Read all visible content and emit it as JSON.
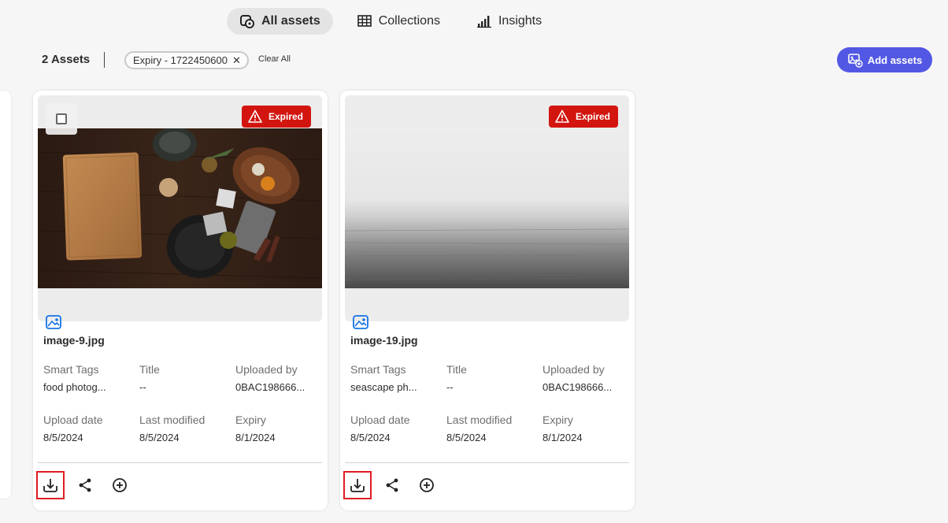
{
  "tabs": [
    {
      "label": "All assets",
      "icon": "assets-icon",
      "active": true
    },
    {
      "label": "Collections",
      "icon": "grid-icon",
      "active": false
    },
    {
      "label": "Insights",
      "icon": "insights-icon",
      "active": false
    }
  ],
  "toolbar": {
    "count_label": "2 Assets",
    "filter_chip": "Expiry - 1722450600",
    "clear_label": "Clear All",
    "add_label": "Add assets"
  },
  "colors": {
    "accent": "#5258e4",
    "expired": "#d31510",
    "highlight": "#e01b24"
  },
  "meta_labels": {
    "smart_tags": "Smart Tags",
    "title": "Title",
    "uploaded_by": "Uploaded by",
    "upload_date": "Upload date",
    "last_modified": "Last modified",
    "expiry": "Expiry"
  },
  "cards": [
    {
      "badge": "Expired",
      "filename": "image-9.jpg",
      "smart_tags": "food photog...",
      "title": "--",
      "uploaded_by": "0BAC198666...",
      "upload_date": "8/5/2024",
      "last_modified": "8/5/2024",
      "expiry": "8/1/2024"
    },
    {
      "badge": "Expired",
      "filename": "image-19.jpg",
      "smart_tags": "seascape ph...",
      "title": "--",
      "uploaded_by": "0BAC198666...",
      "upload_date": "8/5/2024",
      "last_modified": "8/5/2024",
      "expiry": "8/1/2024"
    }
  ]
}
